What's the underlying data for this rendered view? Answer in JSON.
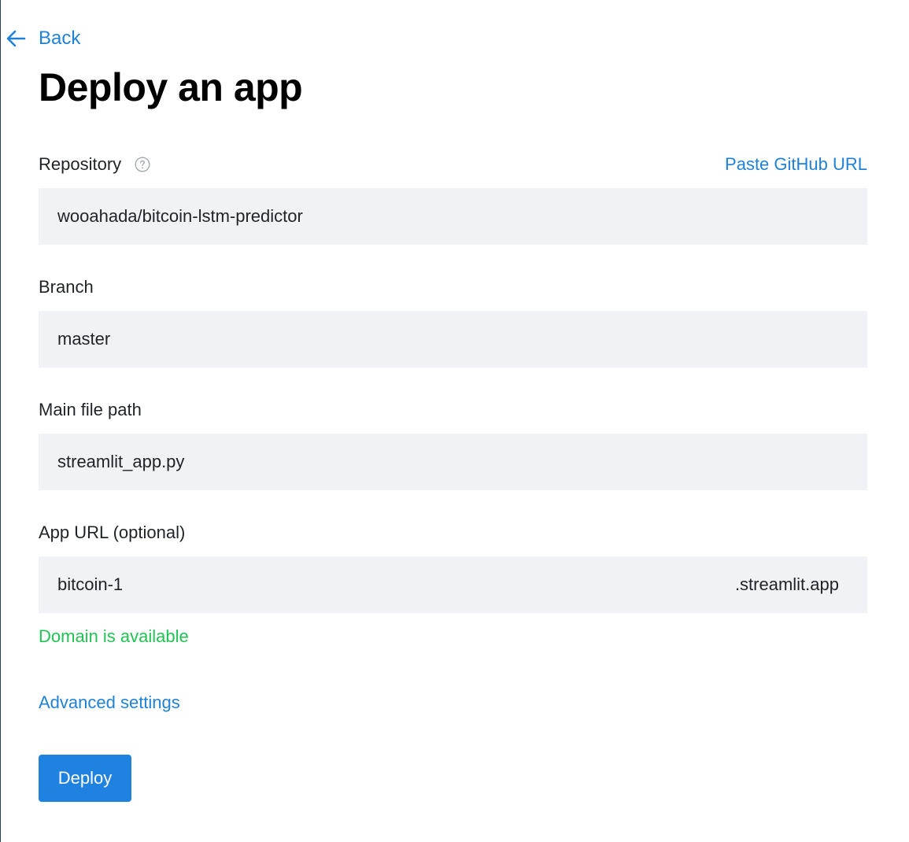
{
  "nav": {
    "back_label": "Back",
    "back_icon": "arrow-left-icon"
  },
  "page": {
    "title": "Deploy an app"
  },
  "form": {
    "repository": {
      "label": "Repository",
      "help_icon": "question-circle-icon",
      "paste_link": "Paste GitHub URL",
      "value": "wooahada/bitcoin-lstm-predictor"
    },
    "branch": {
      "label": "Branch",
      "value": "master"
    },
    "main_file": {
      "label": "Main file path",
      "value": "streamlit_app.py"
    },
    "app_url": {
      "label": "App URL (optional)",
      "value": "bitcoin-1",
      "suffix": ".streamlit.app",
      "status": "Domain is available"
    },
    "advanced_settings": "Advanced settings",
    "deploy_label": "Deploy"
  },
  "colors": {
    "accent": "#1f82d8",
    "button": "#1f82e0",
    "success": "#21c354",
    "input_bg": "#f0f2f6"
  }
}
